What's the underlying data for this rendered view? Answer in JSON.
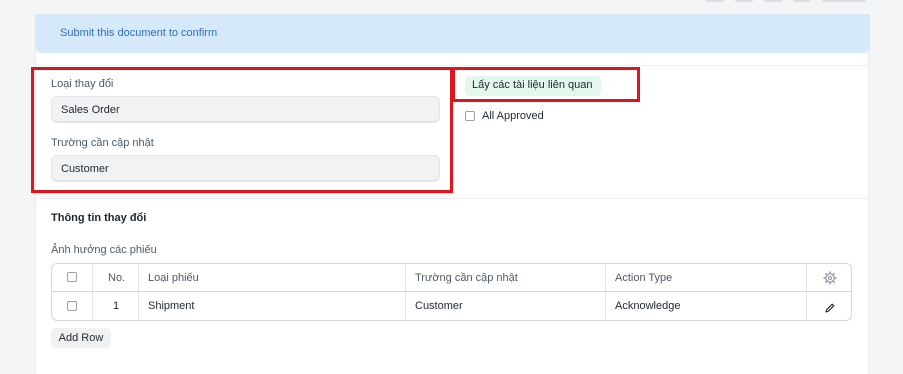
{
  "alert": {
    "text": "Submit this document to confirm"
  },
  "form": {
    "change_type": {
      "label": "Loại thay đổi",
      "value": "Sales Order"
    },
    "field_to_update": {
      "label": "Trường cần cập nhật",
      "value": "Customer"
    },
    "fetch_button": {
      "label": "Lấy các tài liệu liên quan"
    },
    "all_approved": {
      "label": "All Approved",
      "checked": false
    }
  },
  "section": {
    "title": "Thông tin thay đổi",
    "table_label": "Ảnh hưởng các phiếu"
  },
  "table": {
    "columns": [
      "No.",
      "Loại phiếu",
      "Trường cần cập nhật",
      "Action Type"
    ],
    "rows": [
      {
        "no": "1",
        "doc_type": "Shipment",
        "field": "Customer",
        "action": "Acknowledge"
      }
    ]
  },
  "add_row": {
    "label": "Add Row"
  },
  "colors": {
    "highlight": "#e0141e",
    "alert_bg": "#d6e9fb",
    "alert_text": "#2f6fb3",
    "fetch_bg": "#e3f7ec"
  },
  "icons": {
    "settings": "gear-icon",
    "edit": "pencil-icon"
  }
}
